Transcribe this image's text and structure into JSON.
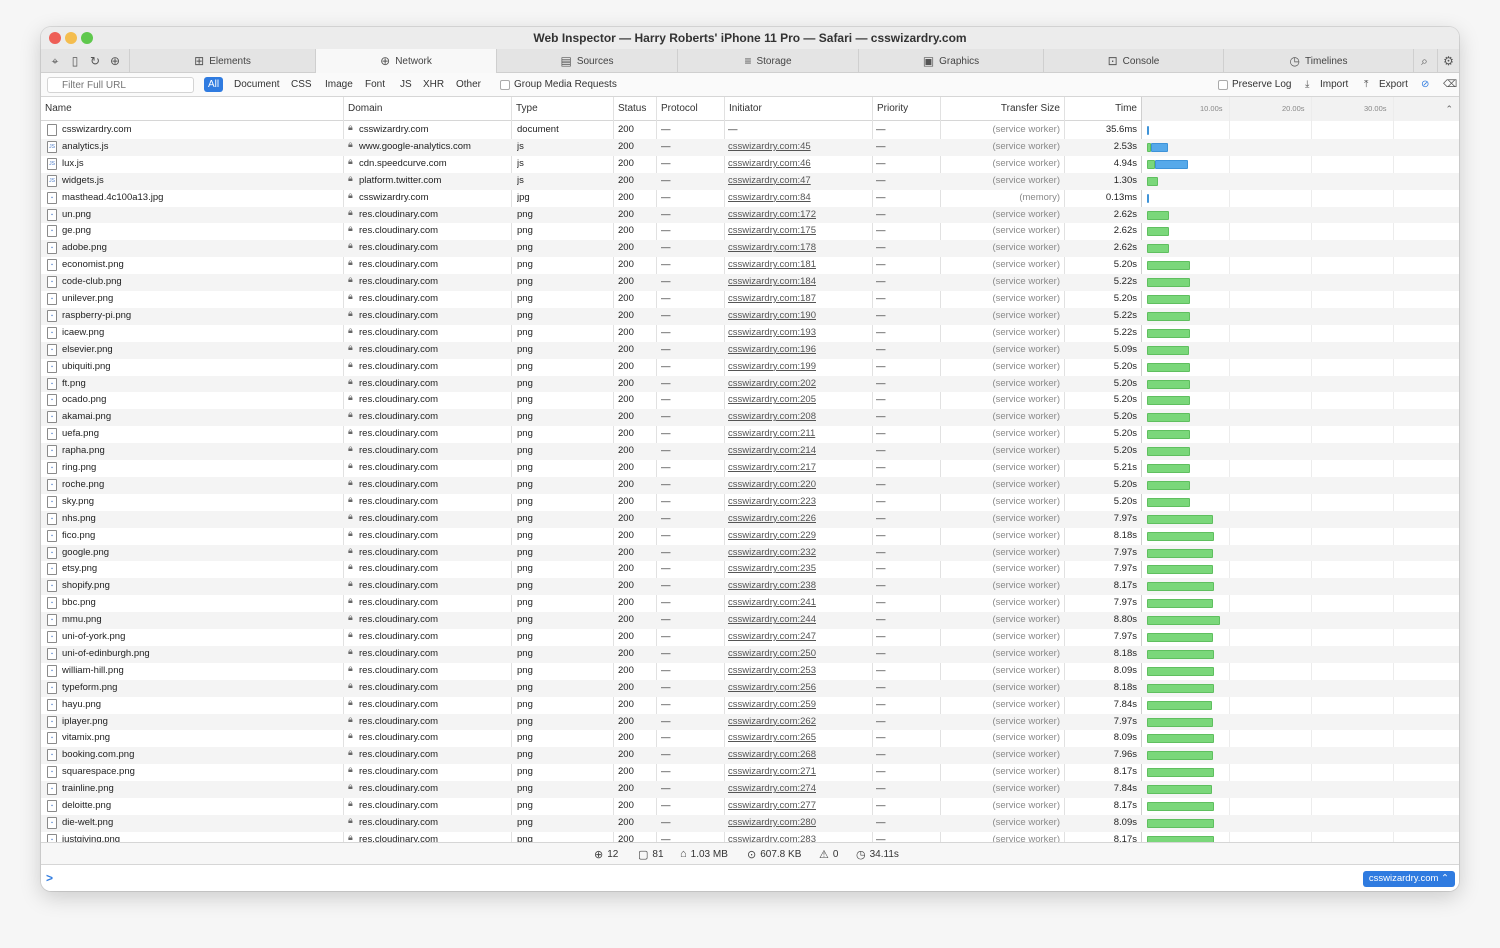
{
  "window": {
    "title": "Web Inspector — Harry Roberts' iPhone 11 Pro — Safari — csswizardry.com"
  },
  "toolbar_icons": [
    "crosshair-icon",
    "device-icon",
    "reload-icon",
    "download-icon"
  ],
  "tabs": [
    {
      "label": "Elements",
      "icon": "elements-icon"
    },
    {
      "label": "Network",
      "icon": "network-icon",
      "active": true
    },
    {
      "label": "Sources",
      "icon": "sources-icon"
    },
    {
      "label": "Storage",
      "icon": "storage-icon"
    },
    {
      "label": "Graphics",
      "icon": "graphics-icon"
    },
    {
      "label": "Console",
      "icon": "console-icon"
    },
    {
      "label": "Timelines",
      "icon": "timelines-icon"
    }
  ],
  "filter": {
    "placeholder": "Filter Full URL",
    "types": [
      "All",
      "Document",
      "CSS",
      "Image",
      "Font",
      "JS",
      "XHR",
      "Other"
    ],
    "selected_type": "All",
    "group_media": "Group Media Requests",
    "preserve_log": "Preserve Log",
    "import": "Import",
    "export": "Export"
  },
  "columns": {
    "name": "Name",
    "domain": "Domain",
    "type": "Type",
    "status": "Status",
    "protocol": "Protocol",
    "initiator": "Initiator",
    "priority": "Priority",
    "transfer": "Transfer Size",
    "time": "Time"
  },
  "waterfall": {
    "ticks": [
      "10.00s",
      "20.00s",
      "30.00s"
    ],
    "max_seconds": 34.11,
    "colors": {
      "cached": "#7ad77a",
      "network": "#56a9ea"
    }
  },
  "requests": [
    {
      "name": "csswizardry.com",
      "domain": "csswizardry.com",
      "type": "document",
      "status": "200",
      "protocol": "—",
      "initiator": "—",
      "priority": "—",
      "transfer": "(service worker)",
      "time": "35.6ms",
      "start_s": 0,
      "dur_s": 0.04,
      "bar": "network"
    },
    {
      "name": "analytics.js",
      "domain": "www.google-analytics.com",
      "type": "js",
      "status": "200",
      "protocol": "—",
      "initiator": "csswizardry.com:45",
      "priority": "—",
      "transfer": "(service worker)",
      "time": "2.53s",
      "start_s": 0.05,
      "dur_s": 2.53,
      "bar": "mixed"
    },
    {
      "name": "lux.js",
      "domain": "cdn.speedcurve.com",
      "type": "js",
      "status": "200",
      "protocol": "—",
      "initiator": "csswizardry.com:46",
      "priority": "—",
      "transfer": "(service worker)",
      "time": "4.94s",
      "start_s": 0.05,
      "dur_s": 4.94,
      "bar": "mixed"
    },
    {
      "name": "widgets.js",
      "domain": "platform.twitter.com",
      "type": "js",
      "status": "200",
      "protocol": "—",
      "initiator": "csswizardry.com:47",
      "priority": "—",
      "transfer": "(service worker)",
      "time": "1.30s",
      "start_s": 0.05,
      "dur_s": 1.3,
      "bar": "cached"
    },
    {
      "name": "masthead.4c100a13.jpg",
      "domain": "csswizardry.com",
      "type": "jpg",
      "status": "200",
      "protocol": "—",
      "initiator": "csswizardry.com:84",
      "priority": "—",
      "transfer": "(memory)",
      "time": "0.13ms",
      "start_s": 0.05,
      "dur_s": 0.01,
      "bar": "network"
    },
    {
      "name": "un.png",
      "domain": "res.cloudinary.com",
      "type": "png",
      "status": "200",
      "protocol": "—",
      "initiator": "csswizardry.com:172",
      "priority": "—",
      "transfer": "(service worker)",
      "time": "2.62s",
      "start_s": 0.05,
      "dur_s": 2.62,
      "bar": "cached"
    },
    {
      "name": "ge.png",
      "domain": "res.cloudinary.com",
      "type": "png",
      "status": "200",
      "protocol": "—",
      "initiator": "csswizardry.com:175",
      "priority": "—",
      "transfer": "(service worker)",
      "time": "2.62s",
      "start_s": 0.05,
      "dur_s": 2.62,
      "bar": "cached"
    },
    {
      "name": "adobe.png",
      "domain": "res.cloudinary.com",
      "type": "png",
      "status": "200",
      "protocol": "—",
      "initiator": "csswizardry.com:178",
      "priority": "—",
      "transfer": "(service worker)",
      "time": "2.62s",
      "start_s": 0.05,
      "dur_s": 2.62,
      "bar": "cached"
    },
    {
      "name": "economist.png",
      "domain": "res.cloudinary.com",
      "type": "png",
      "status": "200",
      "protocol": "—",
      "initiator": "csswizardry.com:181",
      "priority": "—",
      "transfer": "(service worker)",
      "time": "5.20s",
      "start_s": 0.05,
      "dur_s": 5.2,
      "bar": "cached"
    },
    {
      "name": "code-club.png",
      "domain": "res.cloudinary.com",
      "type": "png",
      "status": "200",
      "protocol": "—",
      "initiator": "csswizardry.com:184",
      "priority": "—",
      "transfer": "(service worker)",
      "time": "5.22s",
      "start_s": 0.05,
      "dur_s": 5.22,
      "bar": "cached"
    },
    {
      "name": "unilever.png",
      "domain": "res.cloudinary.com",
      "type": "png",
      "status": "200",
      "protocol": "—",
      "initiator": "csswizardry.com:187",
      "priority": "—",
      "transfer": "(service worker)",
      "time": "5.20s",
      "start_s": 0.05,
      "dur_s": 5.2,
      "bar": "cached"
    },
    {
      "name": "raspberry-pi.png",
      "domain": "res.cloudinary.com",
      "type": "png",
      "status": "200",
      "protocol": "—",
      "initiator": "csswizardry.com:190",
      "priority": "—",
      "transfer": "(service worker)",
      "time": "5.22s",
      "start_s": 0.05,
      "dur_s": 5.22,
      "bar": "cached"
    },
    {
      "name": "icaew.png",
      "domain": "res.cloudinary.com",
      "type": "png",
      "status": "200",
      "protocol": "—",
      "initiator": "csswizardry.com:193",
      "priority": "—",
      "transfer": "(service worker)",
      "time": "5.22s",
      "start_s": 0.05,
      "dur_s": 5.22,
      "bar": "cached"
    },
    {
      "name": "elsevier.png",
      "domain": "res.cloudinary.com",
      "type": "png",
      "status": "200",
      "protocol": "—",
      "initiator": "csswizardry.com:196",
      "priority": "—",
      "transfer": "(service worker)",
      "time": "5.09s",
      "start_s": 0.05,
      "dur_s": 5.09,
      "bar": "cached"
    },
    {
      "name": "ubiquiti.png",
      "domain": "res.cloudinary.com",
      "type": "png",
      "status": "200",
      "protocol": "—",
      "initiator": "csswizardry.com:199",
      "priority": "—",
      "transfer": "(service worker)",
      "time": "5.20s",
      "start_s": 0.05,
      "dur_s": 5.2,
      "bar": "cached"
    },
    {
      "name": "ft.png",
      "domain": "res.cloudinary.com",
      "type": "png",
      "status": "200",
      "protocol": "—",
      "initiator": "csswizardry.com:202",
      "priority": "—",
      "transfer": "(service worker)",
      "time": "5.20s",
      "start_s": 0.05,
      "dur_s": 5.2,
      "bar": "cached"
    },
    {
      "name": "ocado.png",
      "domain": "res.cloudinary.com",
      "type": "png",
      "status": "200",
      "protocol": "—",
      "initiator": "csswizardry.com:205",
      "priority": "—",
      "transfer": "(service worker)",
      "time": "5.20s",
      "start_s": 0.05,
      "dur_s": 5.2,
      "bar": "cached"
    },
    {
      "name": "akamai.png",
      "domain": "res.cloudinary.com",
      "type": "png",
      "status": "200",
      "protocol": "—",
      "initiator": "csswizardry.com:208",
      "priority": "—",
      "transfer": "(service worker)",
      "time": "5.20s",
      "start_s": 0.05,
      "dur_s": 5.2,
      "bar": "cached"
    },
    {
      "name": "uefa.png",
      "domain": "res.cloudinary.com",
      "type": "png",
      "status": "200",
      "protocol": "—",
      "initiator": "csswizardry.com:211",
      "priority": "—",
      "transfer": "(service worker)",
      "time": "5.20s",
      "start_s": 0.05,
      "dur_s": 5.2,
      "bar": "cached"
    },
    {
      "name": "rapha.png",
      "domain": "res.cloudinary.com",
      "type": "png",
      "status": "200",
      "protocol": "—",
      "initiator": "csswizardry.com:214",
      "priority": "—",
      "transfer": "(service worker)",
      "time": "5.20s",
      "start_s": 0.05,
      "dur_s": 5.2,
      "bar": "cached"
    },
    {
      "name": "ring.png",
      "domain": "res.cloudinary.com",
      "type": "png",
      "status": "200",
      "protocol": "—",
      "initiator": "csswizardry.com:217",
      "priority": "—",
      "transfer": "(service worker)",
      "time": "5.21s",
      "start_s": 0.05,
      "dur_s": 5.21,
      "bar": "cached"
    },
    {
      "name": "roche.png",
      "domain": "res.cloudinary.com",
      "type": "png",
      "status": "200",
      "protocol": "—",
      "initiator": "csswizardry.com:220",
      "priority": "—",
      "transfer": "(service worker)",
      "time": "5.20s",
      "start_s": 0.05,
      "dur_s": 5.2,
      "bar": "cached"
    },
    {
      "name": "sky.png",
      "domain": "res.cloudinary.com",
      "type": "png",
      "status": "200",
      "protocol": "—",
      "initiator": "csswizardry.com:223",
      "priority": "—",
      "transfer": "(service worker)",
      "time": "5.20s",
      "start_s": 0.05,
      "dur_s": 5.2,
      "bar": "cached"
    },
    {
      "name": "nhs.png",
      "domain": "res.cloudinary.com",
      "type": "png",
      "status": "200",
      "protocol": "—",
      "initiator": "csswizardry.com:226",
      "priority": "—",
      "transfer": "(service worker)",
      "time": "7.97s",
      "start_s": 0.05,
      "dur_s": 7.97,
      "bar": "cached"
    },
    {
      "name": "fico.png",
      "domain": "res.cloudinary.com",
      "type": "png",
      "status": "200",
      "protocol": "—",
      "initiator": "csswizardry.com:229",
      "priority": "—",
      "transfer": "(service worker)",
      "time": "8.18s",
      "start_s": 0.05,
      "dur_s": 8.18,
      "bar": "cached"
    },
    {
      "name": "google.png",
      "domain": "res.cloudinary.com",
      "type": "png",
      "status": "200",
      "protocol": "—",
      "initiator": "csswizardry.com:232",
      "priority": "—",
      "transfer": "(service worker)",
      "time": "7.97s",
      "start_s": 0.05,
      "dur_s": 7.97,
      "bar": "cached"
    },
    {
      "name": "etsy.png",
      "domain": "res.cloudinary.com",
      "type": "png",
      "status": "200",
      "protocol": "—",
      "initiator": "csswizardry.com:235",
      "priority": "—",
      "transfer": "(service worker)",
      "time": "7.97s",
      "start_s": 0.05,
      "dur_s": 7.97,
      "bar": "cached"
    },
    {
      "name": "shopify.png",
      "domain": "res.cloudinary.com",
      "type": "png",
      "status": "200",
      "protocol": "—",
      "initiator": "csswizardry.com:238",
      "priority": "—",
      "transfer": "(service worker)",
      "time": "8.17s",
      "start_s": 0.05,
      "dur_s": 8.17,
      "bar": "cached"
    },
    {
      "name": "bbc.png",
      "domain": "res.cloudinary.com",
      "type": "png",
      "status": "200",
      "protocol": "—",
      "initiator": "csswizardry.com:241",
      "priority": "—",
      "transfer": "(service worker)",
      "time": "7.97s",
      "start_s": 0.05,
      "dur_s": 7.97,
      "bar": "cached"
    },
    {
      "name": "mmu.png",
      "domain": "res.cloudinary.com",
      "type": "png",
      "status": "200",
      "protocol": "—",
      "initiator": "csswizardry.com:244",
      "priority": "—",
      "transfer": "(service worker)",
      "time": "8.80s",
      "start_s": 0.05,
      "dur_s": 8.8,
      "bar": "cached"
    },
    {
      "name": "uni-of-york.png",
      "domain": "res.cloudinary.com",
      "type": "png",
      "status": "200",
      "protocol": "—",
      "initiator": "csswizardry.com:247",
      "priority": "—",
      "transfer": "(service worker)",
      "time": "7.97s",
      "start_s": 0.05,
      "dur_s": 7.97,
      "bar": "cached"
    },
    {
      "name": "uni-of-edinburgh.png",
      "domain": "res.cloudinary.com",
      "type": "png",
      "status": "200",
      "protocol": "—",
      "initiator": "csswizardry.com:250",
      "priority": "—",
      "transfer": "(service worker)",
      "time": "8.18s",
      "start_s": 0.05,
      "dur_s": 8.18,
      "bar": "cached"
    },
    {
      "name": "william-hill.png",
      "domain": "res.cloudinary.com",
      "type": "png",
      "status": "200",
      "protocol": "—",
      "initiator": "csswizardry.com:253",
      "priority": "—",
      "transfer": "(service worker)",
      "time": "8.09s",
      "start_s": 0.05,
      "dur_s": 8.09,
      "bar": "cached"
    },
    {
      "name": "typeform.png",
      "domain": "res.cloudinary.com",
      "type": "png",
      "status": "200",
      "protocol": "—",
      "initiator": "csswizardry.com:256",
      "priority": "—",
      "transfer": "(service worker)",
      "time": "8.18s",
      "start_s": 0.05,
      "dur_s": 8.18,
      "bar": "cached"
    },
    {
      "name": "hayu.png",
      "domain": "res.cloudinary.com",
      "type": "png",
      "status": "200",
      "protocol": "—",
      "initiator": "csswizardry.com:259",
      "priority": "—",
      "transfer": "(service worker)",
      "time": "7.84s",
      "start_s": 0.05,
      "dur_s": 7.84,
      "bar": "cached"
    },
    {
      "name": "iplayer.png",
      "domain": "res.cloudinary.com",
      "type": "png",
      "status": "200",
      "protocol": "—",
      "initiator": "csswizardry.com:262",
      "priority": "—",
      "transfer": "(service worker)",
      "time": "7.97s",
      "start_s": 0.05,
      "dur_s": 7.97,
      "bar": "cached"
    },
    {
      "name": "vitamix.png",
      "domain": "res.cloudinary.com",
      "type": "png",
      "status": "200",
      "protocol": "—",
      "initiator": "csswizardry.com:265",
      "priority": "—",
      "transfer": "(service worker)",
      "time": "8.09s",
      "start_s": 0.05,
      "dur_s": 8.09,
      "bar": "cached"
    },
    {
      "name": "booking.com.png",
      "domain": "res.cloudinary.com",
      "type": "png",
      "status": "200",
      "protocol": "—",
      "initiator": "csswizardry.com:268",
      "priority": "—",
      "transfer": "(service worker)",
      "time": "7.96s",
      "start_s": 0.05,
      "dur_s": 7.96,
      "bar": "cached"
    },
    {
      "name": "squarespace.png",
      "domain": "res.cloudinary.com",
      "type": "png",
      "status": "200",
      "protocol": "—",
      "initiator": "csswizardry.com:271",
      "priority": "—",
      "transfer": "(service worker)",
      "time": "8.17s",
      "start_s": 0.05,
      "dur_s": 8.17,
      "bar": "cached"
    },
    {
      "name": "trainline.png",
      "domain": "res.cloudinary.com",
      "type": "png",
      "status": "200",
      "protocol": "—",
      "initiator": "csswizardry.com:274",
      "priority": "—",
      "transfer": "(service worker)",
      "time": "7.84s",
      "start_s": 0.05,
      "dur_s": 7.84,
      "bar": "cached"
    },
    {
      "name": "deloitte.png",
      "domain": "res.cloudinary.com",
      "type": "png",
      "status": "200",
      "protocol": "—",
      "initiator": "csswizardry.com:277",
      "priority": "—",
      "transfer": "(service worker)",
      "time": "8.17s",
      "start_s": 0.05,
      "dur_s": 8.17,
      "bar": "cached"
    },
    {
      "name": "die-welt.png",
      "domain": "res.cloudinary.com",
      "type": "png",
      "status": "200",
      "protocol": "—",
      "initiator": "csswizardry.com:280",
      "priority": "—",
      "transfer": "(service worker)",
      "time": "8.09s",
      "start_s": 0.05,
      "dur_s": 8.09,
      "bar": "cached"
    },
    {
      "name": "justgiving.png",
      "domain": "res.cloudinary.com",
      "type": "png",
      "status": "200",
      "protocol": "—",
      "initiator": "csswizardry.com:283",
      "priority": "—",
      "transfer": "(service worker)",
      "time": "8.17s",
      "start_s": 0.05,
      "dur_s": 8.17,
      "bar": "cached"
    }
  ],
  "footer": {
    "domains": "12",
    "resources": "81",
    "size": "1.03 MB",
    "transferred": "607.8 KB",
    "errors": "0",
    "duration": "34.11s"
  },
  "console": {
    "prompt": ">",
    "target": "csswizardry.com"
  }
}
